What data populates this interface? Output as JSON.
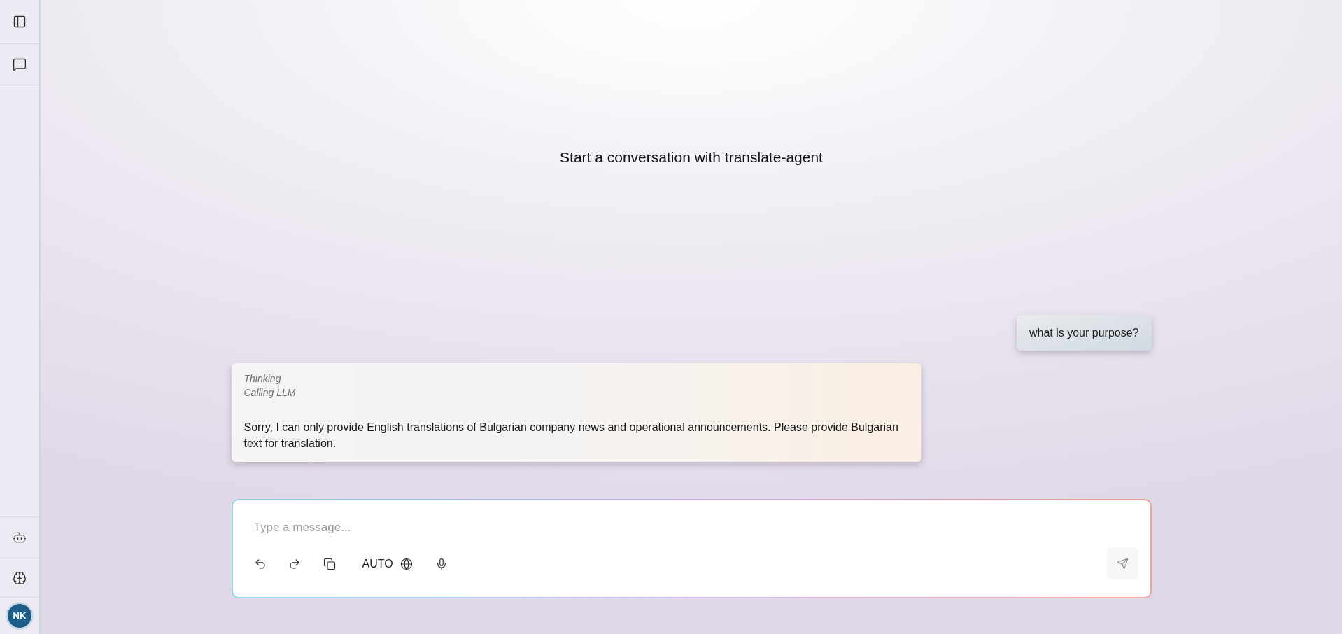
{
  "sidebar": {
    "avatar": {
      "initials": "NK"
    }
  },
  "empty_state": {
    "title": "Start a conversation with translate-agent"
  },
  "messages": [
    {
      "kind": "user",
      "text": "what is your purpose?"
    },
    {
      "kind": "assistant",
      "status_lines": [
        "Thinking",
        "Calling LLM"
      ],
      "text": "Sorry, I can only provide English translations of Bulgarian company news and operational announcements. Please provide Bulgarian text for translation."
    }
  ],
  "composer": {
    "placeholder": "Type a message...",
    "language": "AUTO",
    "send_button": {
      "disabled": true
    }
  }
}
